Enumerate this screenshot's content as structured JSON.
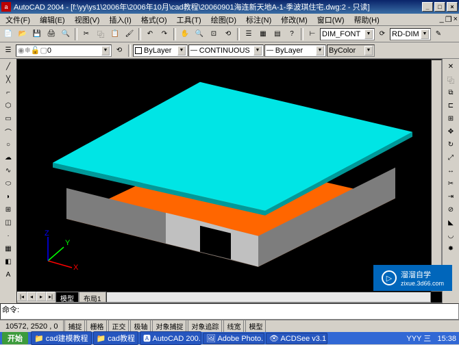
{
  "title": "AutoCAD 2004 - [f:\\yy\\ys1\\2006年\\2006年10月\\cad教程\\20060901海连新天地A-1-季波琪住宅.dwg:2 - 只读]",
  "menu": {
    "items": [
      "文件(F)",
      "编辑(E)",
      "视图(V)",
      "插入(I)",
      "格式(O)",
      "工具(T)",
      "绘图(D)",
      "标注(N)",
      "修改(M)",
      "窗口(W)",
      "帮助(H)"
    ]
  },
  "tool1": {
    "icons": [
      "new-file-icon",
      "open-icon",
      "save-icon",
      "print-icon",
      "preview-icon",
      "cut-icon",
      "copy-icon",
      "paste-icon",
      "match-icon",
      "undo-icon",
      "redo-icon",
      "eraser-icon",
      "ucs-icon",
      "pan-icon",
      "zoom-icon",
      "zoom-window-icon",
      "zoom-prev-icon",
      "properties-icon",
      "dbconnect-icon",
      "help-icon",
      "ortho-icon",
      "sheet-icon"
    ],
    "dim_style": "DIM_FONT",
    "dim_scale": "RD-DIM"
  },
  "tool2": {
    "layer_combo": "0",
    "linetype_combo": "CONTINUOUS",
    "lineweight_combo": "ByLayer",
    "color_combo": "ByLayer",
    "plotstyle_combo": "ByColor"
  },
  "model_tabs": {
    "active": "模型",
    "others": [
      "布局1"
    ]
  },
  "cmd": {
    "l1": "",
    "l2": "命令:"
  },
  "status": {
    "coords": "10572, 2520 , 0",
    "btns": [
      "捕捉",
      "栅格",
      "正交",
      "极轴",
      "对象捕捉",
      "对象追踪",
      "线宽",
      "模型"
    ]
  },
  "taskbar": {
    "start": "开始",
    "tasks": [
      "cad建模教程",
      "cad教程",
      "AutoCAD 200...",
      "Adobe Photo...",
      "ACDSee v3.1..."
    ],
    "tray": "YYY 三",
    "clock": "15:38"
  },
  "watermark": {
    "brand": "溜溜自学",
    "url": "zixue.3d66.com"
  }
}
